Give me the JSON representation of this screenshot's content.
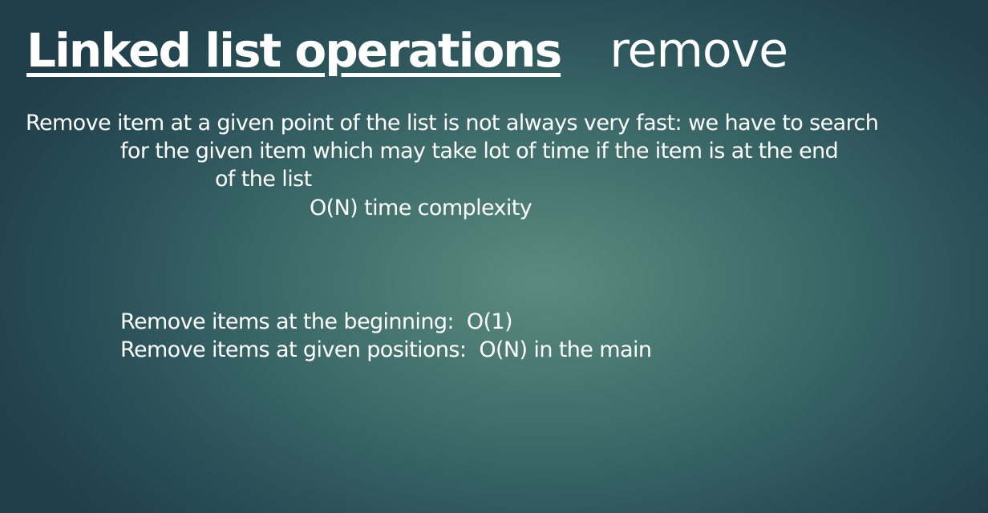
{
  "slide": {
    "title": "Linked list operations",
    "subtitle": "remove",
    "lines": [
      "Remove item at a given point of the list is not always very fast: we have to search",
      "for the given item which may take lot of time if the item is at the end",
      "of the list",
      "O(N) time complexity",
      "Remove items at the beginning:  O(1)",
      "Remove items at given positions:  O(N) in the main"
    ]
  }
}
